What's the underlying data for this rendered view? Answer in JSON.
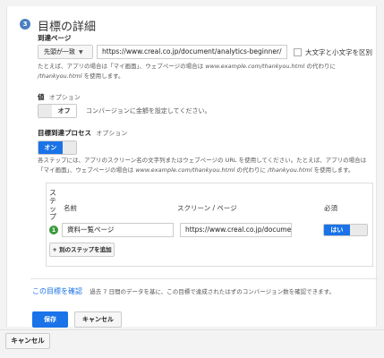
{
  "goal_details": {
    "step_number": "3",
    "title": "目標の詳細",
    "destination": {
      "label": "到達ページ",
      "match_type": "先頭が一致",
      "url_value": "https://www.creal.co.jp/document/analytics-beginner/",
      "case_sensitive_label": "大文字と小文字を区別",
      "help_prefix": "たとえば、アプリの場合は「マイ画面」、ウェブページの場合は ",
      "help_example1": "www.example.com/thankyou.html",
      "help_mid": " の代わりに ",
      "help_example2": "/thankyou.html",
      "help_suffix": " を使用します。"
    },
    "value": {
      "label": "値",
      "optional": "オプション",
      "toggle_label": "オフ",
      "description": "コンバージョンに金額を設定してください。"
    },
    "funnel": {
      "label": "目標到達プロセス",
      "optional": "オプション",
      "toggle_label": "オン",
      "help_prefix": "各ステップには、アプリのスクリーン名の文字列またはウェブページの URL を使用してください。たとえば、アプリの場合は「マイ画面」、ウェブページの場合は ",
      "help_example1": "www.example.com/thankyou.html",
      "help_mid": " の代わりに ",
      "help_example2": "/thankyou.html",
      "help_suffix": " を使用します。",
      "columns": {
        "step": "ステップ",
        "name": "名前",
        "screen": "スクリーン / ページ",
        "required": "必須"
      },
      "steps": [
        {
          "number": "1",
          "name": "資料一覧ページ",
          "screen": "https://www.creal.co.jp/document/",
          "required": "はい"
        }
      ],
      "add_step_label": "+ 別のステップを追加"
    },
    "verify": {
      "link": "この目標を確認",
      "description": "過去 7 日間のデータを基に、この目標で達成されたはずのコンバージョン数を確認できます。"
    },
    "save_label": "保存",
    "cancel_label": "キャンセル"
  },
  "footer": {
    "cancel_label": "キャンセル"
  },
  "colors": {
    "accent": "#1a73e8",
    "step_badge": "#4a7fc1",
    "step_dot": "#3c9a3c"
  }
}
